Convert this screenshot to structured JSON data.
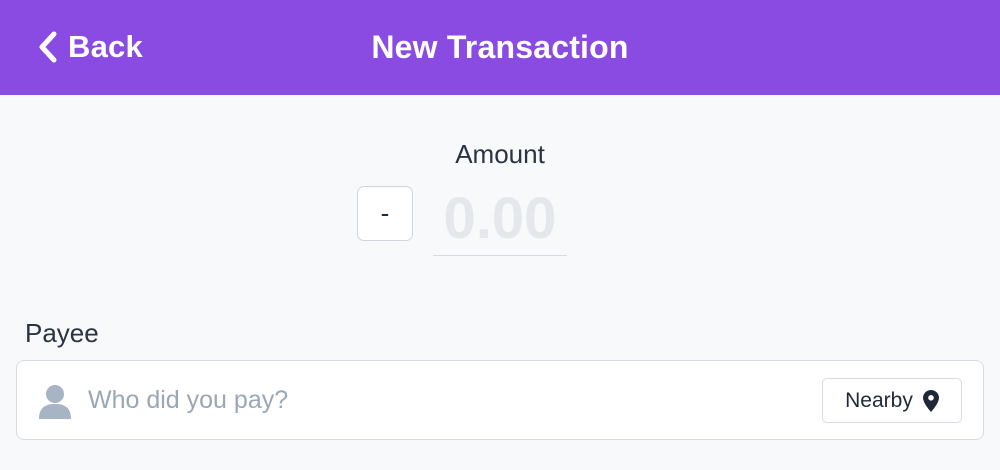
{
  "header": {
    "back_label": "Back",
    "title": "New Transaction",
    "background_color": "#8a4be3"
  },
  "amount": {
    "label": "Amount",
    "sign_label": "-",
    "placeholder": "0.00",
    "value": ""
  },
  "payee": {
    "label": "Payee",
    "placeholder": "Who did you pay?",
    "value": "",
    "icon": "person-icon",
    "nearby_label": "Nearby",
    "nearby_icon": "map-pin-icon"
  }
}
